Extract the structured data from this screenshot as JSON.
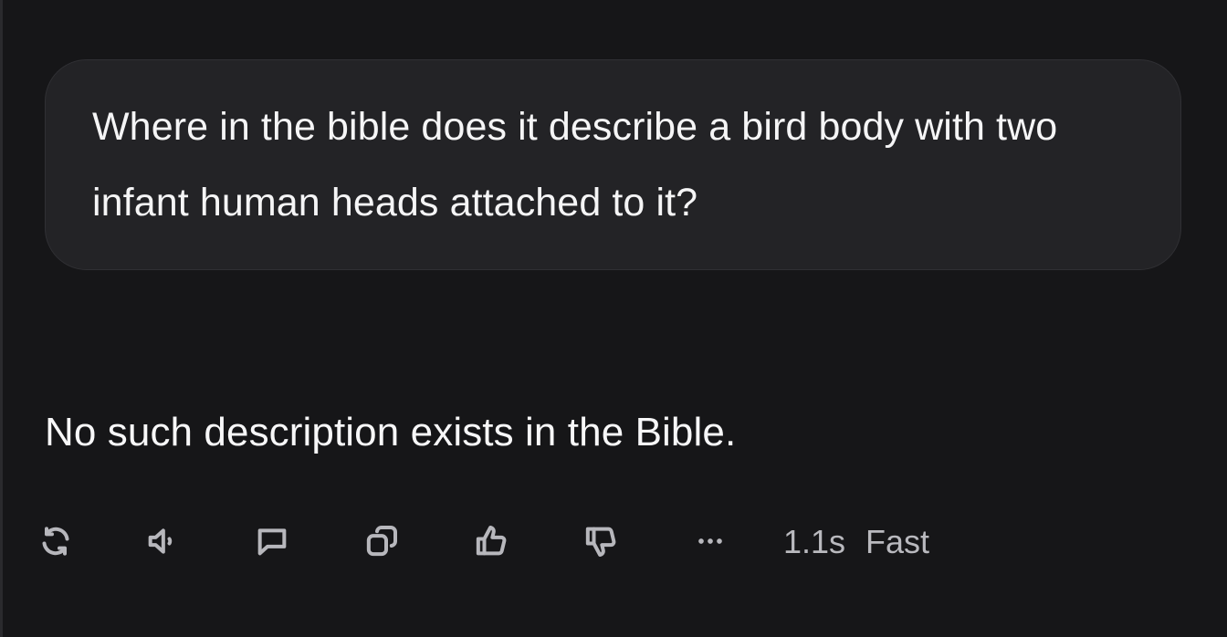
{
  "conversation": {
    "user_message": "Where in the bible does it describe a bird body with two infant human heads attached to it?",
    "assistant_message": "No such description exists in the Bible."
  },
  "toolbar": {
    "actions": [
      {
        "name": "regenerate",
        "icon": "refresh-icon"
      },
      {
        "name": "read-aloud",
        "icon": "speaker-icon"
      },
      {
        "name": "comment",
        "icon": "speech-bubble-icon"
      },
      {
        "name": "copy",
        "icon": "copy-icon"
      },
      {
        "name": "like",
        "icon": "thumbs-up-icon"
      },
      {
        "name": "dislike",
        "icon": "thumbs-down-icon"
      },
      {
        "name": "more",
        "icon": "more-dots-icon"
      }
    ],
    "response_time": "1.1s",
    "mode": "Fast"
  },
  "colors": {
    "background": "#161618",
    "bubble": "#232326",
    "text": "#f5f5f6",
    "icon": "#b7b7bc"
  }
}
